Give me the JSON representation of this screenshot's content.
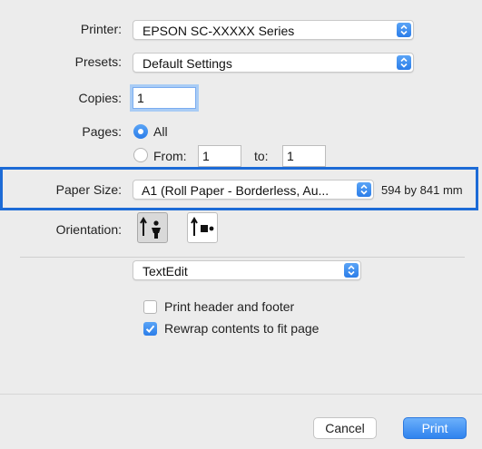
{
  "printer": {
    "label": "Printer:",
    "value": "EPSON SC-XXXXX Series"
  },
  "presets": {
    "label": "Presets:",
    "value": "Default Settings"
  },
  "copies": {
    "label": "Copies:",
    "value": "1"
  },
  "pages": {
    "label": "Pages:",
    "all_label": "All",
    "from_label": "From:",
    "from_value": "1",
    "to_label": "to:",
    "to_value": "1"
  },
  "paper_size": {
    "label": "Paper Size:",
    "value": "A1 (Roll Paper - Borderless, Au...",
    "dimensions": "594 by 841 mm"
  },
  "orientation": {
    "label": "Orientation:",
    "selected": "portrait"
  },
  "section_popup": {
    "value": "TextEdit"
  },
  "options": {
    "header_footer": {
      "label": "Print header and footer",
      "checked": false
    },
    "rewrap": {
      "label": "Rewrap contents to fit page",
      "checked": true
    }
  },
  "buttons": {
    "cancel": "Cancel",
    "print": "Print"
  },
  "colors": {
    "accent": "#2b7de9",
    "highlight_border": "#1d6bd6",
    "background": "#ececec"
  }
}
